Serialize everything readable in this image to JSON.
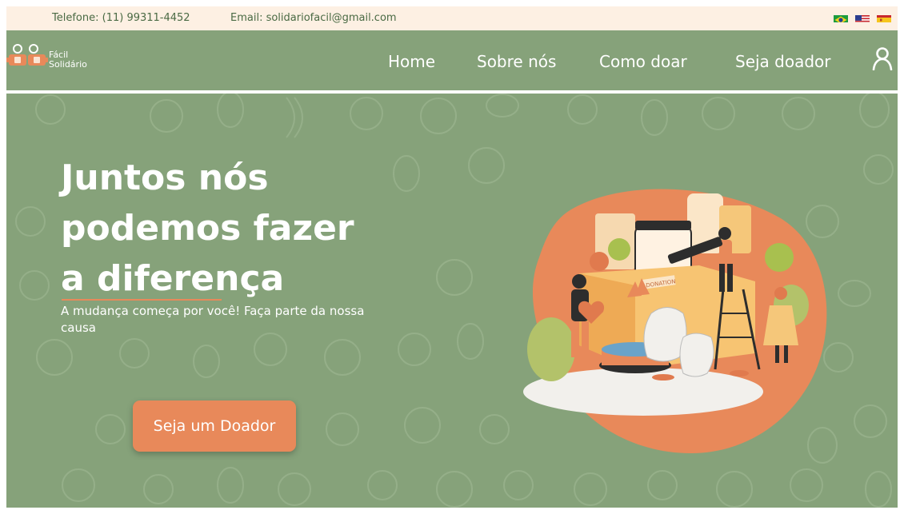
{
  "topbar": {
    "phone": "Telefone: (11) 99311-4452",
    "email": "Email: solidariofacil@gmail.com",
    "languages": [
      {
        "name": "flag-brazil-icon",
        "label": "Português"
      },
      {
        "name": "flag-usa-icon",
        "label": "English"
      },
      {
        "name": "flag-spain-icon",
        "label": "Español"
      }
    ]
  },
  "logo": {
    "line1": "Fácil",
    "line2": "Solidário"
  },
  "nav": {
    "items": [
      "Home",
      "Sobre nós",
      "Como doar",
      "Seja doador"
    ],
    "user_icon": "user-icon"
  },
  "hero": {
    "headline": [
      "Juntos nós",
      "podemos fazer",
      "a diferença"
    ],
    "subtitle": "A mudança começa por você! Faça parte da nossa causa",
    "cta": "Seja um Doador",
    "box_label": "DONATION"
  },
  "colors": {
    "green": "#86a27a",
    "cream": "#fdf0e3",
    "orange": "#e8895a",
    "white": "#ffffff"
  }
}
